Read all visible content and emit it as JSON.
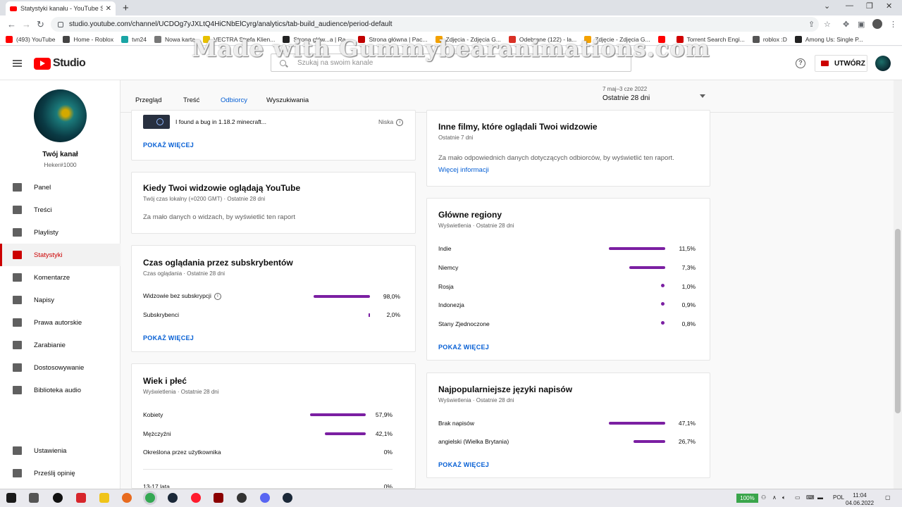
{
  "browser": {
    "tab_title": "Statystyki kanału - YouTube Stud",
    "url": "studio.youtube.com/channel/UCDOg7yJXLtQ4HiCNbElCyrg/analytics/tab-build_audience/period-default",
    "bookmarks": [
      {
        "label": "(493) YouTube",
        "color": "#ff0000"
      },
      {
        "label": "Home - Roblox",
        "color": "#444444"
      },
      {
        "label": "tvn24",
        "color": "#1aa5a5"
      },
      {
        "label": "Nowa karta",
        "color": "#777777"
      },
      {
        "label": "VECTRA Strefa Klien...",
        "color": "#e8c000"
      },
      {
        "label": "Strona głów...a | Ra...",
        "color": "#222222"
      },
      {
        "label": "Strona główna | Pac...",
        "color": "#c00000"
      },
      {
        "label": "Zdjęcia - Zdjęcia G...",
        "color": "#f4a100"
      },
      {
        "label": "Odebrane (122) - la...",
        "color": "#d93025"
      },
      {
        "label": "Zdjęcie - Zdjęcia G...",
        "color": "#f4a100"
      },
      {
        "label": "",
        "color": "#ff0000"
      },
      {
        "label": "Torrent Search Engi...",
        "color": "#d00000"
      },
      {
        "label": "roblox :D",
        "color": "#555555"
      },
      {
        "label": "Among Us: Single P...",
        "color": "#222222"
      }
    ]
  },
  "watermark": "Made with Gummybearanimations.com",
  "header": {
    "logo_text": "Studio",
    "search_placeholder": "Szukaj na swoim kanale",
    "help_glyph": "?",
    "create_label": "UTWÓRZ"
  },
  "sidebar": {
    "channel_name": "Twój kanał",
    "channel_handle": "Heker#1000",
    "items": [
      {
        "label": "Panel",
        "active": false
      },
      {
        "label": "Treści",
        "active": false
      },
      {
        "label": "Playlisty",
        "active": false
      },
      {
        "label": "Statystyki",
        "active": true
      },
      {
        "label": "Komentarze",
        "active": false
      },
      {
        "label": "Napisy",
        "active": false
      },
      {
        "label": "Prawa autorskie",
        "active": false
      },
      {
        "label": "Zarabianie",
        "active": false
      },
      {
        "label": "Dostosowywanie",
        "active": false
      },
      {
        "label": "Biblioteka audio",
        "active": false
      }
    ],
    "bottom_items": [
      {
        "label": "Ustawienia"
      },
      {
        "label": "Prześlij opinię"
      }
    ]
  },
  "tabs": [
    "Przegląd",
    "Treść",
    "Odbiorcy",
    "Wyszukiwania"
  ],
  "active_tab": "Odbiorcy",
  "period": {
    "range": "7 maj–3 cze 2022",
    "label": "Ostatnie 28 dni"
  },
  "left_column": {
    "top_video": {
      "title": "I found a bug in 1.18.2 minecraft...",
      "status": "Niska",
      "link": "POKAŻ WIĘCEJ"
    },
    "when_watching": {
      "title": "Kiedy Twoi widzowie oglądają YouTube",
      "subtitle": "Twój czas lokalny (+0200 GMT) · Ostatnie 28 dni",
      "message": "Za mało danych o widzach, by wyświetlić ten raport"
    },
    "subscriber_watch_time": {
      "title": "Czas oglądania przez subskrybentów",
      "subtitle": "Czas oglądania · Ostatnie 28 dni",
      "rows": [
        {
          "label": "Widzowie bez subskrypcji",
          "value": "98,0%",
          "percent": 98.0
        },
        {
          "label": "Subskrybenci",
          "value": "2,0%",
          "percent": 2.0
        }
      ],
      "link": "POKAŻ WIĘCEJ"
    },
    "age_gender": {
      "title": "Wiek i płeć",
      "subtitle": "Wyświetlenia · Ostatnie 28 dni",
      "rows": [
        {
          "label": "Kobiety",
          "value": "57,9%",
          "percent": 57.9
        },
        {
          "label": "Mężczyźni",
          "value": "42,1%",
          "percent": 42.1
        },
        {
          "label": "Określona przez użytkownika",
          "value": "0%",
          "percent": 0
        }
      ],
      "age_rows": [
        {
          "label": "13-17 lata",
          "value": "0%"
        }
      ]
    }
  },
  "right_column": {
    "other_videos": {
      "title": "Inne filmy, które oglądali Twoi widzowie",
      "subtitle": "Ostatnie 7 dni",
      "message": "Za mało odpowiednich danych dotyczących odbiorców, by wyświetlić ten raport.",
      "link": "Więcej informacji"
    },
    "regions": {
      "title": "Główne regiony",
      "subtitle": "Wyświetlenia · Ostatnie 28 dni",
      "rows": [
        {
          "label": "Indie",
          "value": "11,5%",
          "percent": 11.5
        },
        {
          "label": "Niemcy",
          "value": "7,3%",
          "percent": 7.3
        },
        {
          "label": "Rosja",
          "value": "1,0%",
          "percent": 1.0
        },
        {
          "label": "Indonezja",
          "value": "0,9%",
          "percent": 0.9
        },
        {
          "label": "Stany Zjednoczone",
          "value": "0,8%",
          "percent": 0.8
        }
      ],
      "link": "POKAŻ WIĘCEJ"
    },
    "subtitle_languages": {
      "title": "Najpopularniejsze języki napisów",
      "subtitle": "Wyświetlenia · Ostatnie 28 dni",
      "rows": [
        {
          "label": "Brak napisów",
          "value": "47,1%",
          "percent": 47.1
        },
        {
          "label": "angielski (Wielka Brytania)",
          "value": "26,7%",
          "percent": 26.7
        }
      ],
      "link": "POKAŻ WIĘCEJ"
    }
  },
  "taskbar": {
    "battery": "100%",
    "language": "POL",
    "time": "11:04",
    "date": "04.06.2022"
  },
  "colors": {
    "accent": "#065fd4",
    "bar": "#7b1fa2",
    "brand": "#ff0000",
    "active_nav": "#cc0000"
  }
}
